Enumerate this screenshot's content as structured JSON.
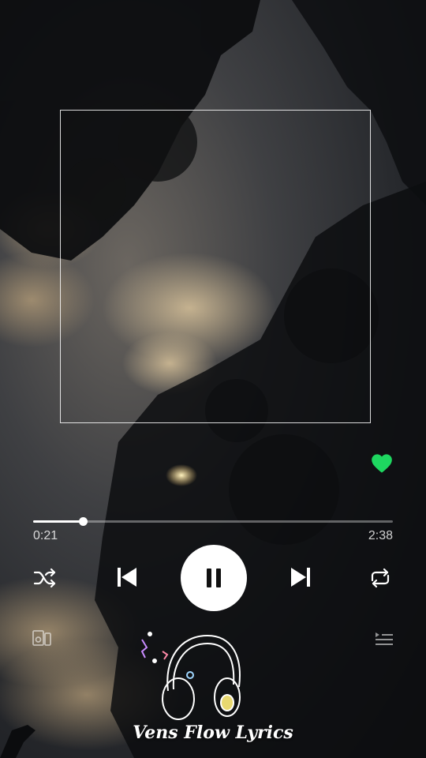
{
  "player": {
    "liked": true,
    "progress_fraction": 0.14,
    "elapsed": "0:21",
    "duration": "2:38",
    "state": "playing"
  },
  "icons": {
    "heart": "heart-icon",
    "shuffle": "shuffle-icon",
    "previous": "skip-previous-icon",
    "pause": "pause-icon",
    "next": "skip-next-icon",
    "repeat": "repeat-icon",
    "devices": "devices-icon",
    "queue": "queue-icon",
    "headphones": "headphones-logo-icon"
  },
  "watermark": {
    "text": "Vens Flow Lyrics"
  },
  "colors": {
    "accent": "#1ed760",
    "text": "#ffffff"
  }
}
